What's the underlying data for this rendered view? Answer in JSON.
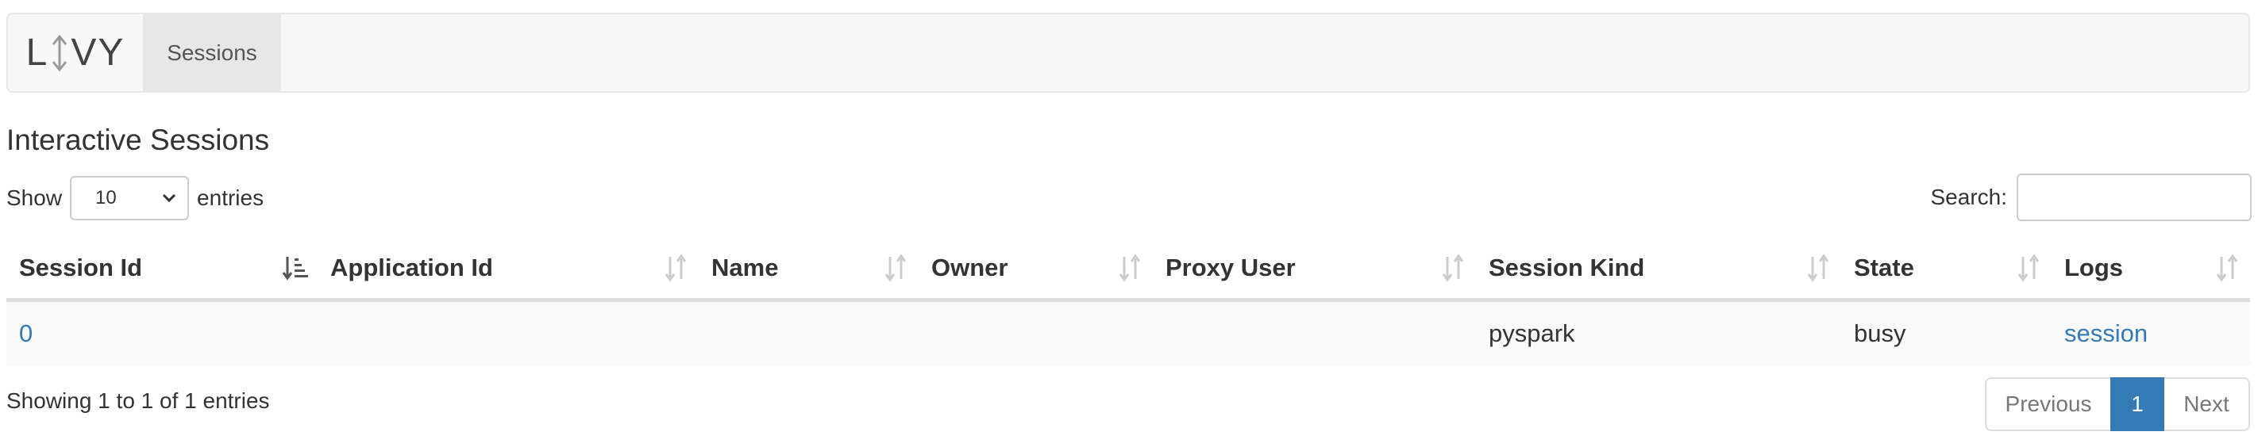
{
  "navbar": {
    "brand_left": "L",
    "brand_right": "VY",
    "items": [
      {
        "label": "Sessions",
        "active": true
      }
    ]
  },
  "main": {
    "title": "Interactive Sessions",
    "length": {
      "prefix": "Show",
      "value": "10",
      "suffix": "entries"
    },
    "search": {
      "label": "Search:",
      "value": ""
    },
    "table": {
      "columns": [
        "Session Id",
        "Application Id",
        "Name",
        "Owner",
        "Proxy User",
        "Session Kind",
        "State",
        "Logs"
      ],
      "sorted_column": "Session Id",
      "sort_direction": "ascending",
      "rows": [
        {
          "session_id": "0",
          "application_id": "",
          "name": "",
          "owner": "",
          "proxy_user": "",
          "session_kind": "pyspark",
          "state": "busy",
          "logs": "session"
        }
      ]
    },
    "info": "Showing 1 to 1 of 1 entries",
    "pagination": {
      "previous": "Previous",
      "current": "1",
      "next": "Next"
    }
  },
  "colors": {
    "link": "#337ab7",
    "active_page": "#337ab7",
    "navbar_bg": "#f8f8f8",
    "nav_active_bg": "#e7e7e7"
  }
}
